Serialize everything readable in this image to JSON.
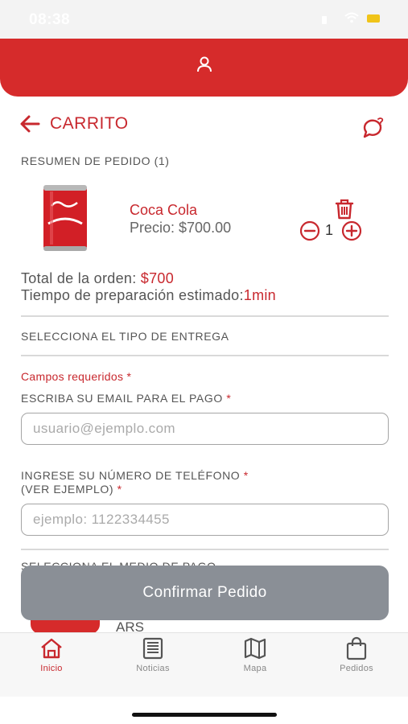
{
  "status_bar": {
    "time": "08:38"
  },
  "header": {
    "icon": "user-icon"
  },
  "cart": {
    "title": "CARRITO"
  },
  "summary": {
    "label": "RESUMEN DE PEDIDO (1)"
  },
  "product": {
    "name": "Coca Cola",
    "price": "Precio: $700.00",
    "quantity": "1",
    "image_icon": "coca-cola-can-icon"
  },
  "order": {
    "total_label": "Total de la orden: ",
    "total_value": "$700",
    "prep_label": "Tiempo de preparación estimado:",
    "prep_value": "1min"
  },
  "delivery": {
    "label": "SELECCIONA EL TIPO DE ENTREGA"
  },
  "form": {
    "required_note": "Campos requeridos",
    "required_mark": "*",
    "email_label": "ESCRIBA SU EMAIL PARA EL PAGO",
    "email_placeholder": "usuario@ejemplo.com",
    "phone_label_line1": "INGRESE SU NÚMERO DE TELÉFONO",
    "phone_label_line2": "(VER EJEMPLO)",
    "phone_placeholder": "ejemplo: 1122334455"
  },
  "payment": {
    "header": "SELECCIONA EL MEDIO DE PAGO",
    "option_text": "ARS"
  },
  "confirm_button": {
    "label": "Confirmar Pedido"
  },
  "tabs": [
    {
      "label": "Inicio",
      "icon": "home-icon",
      "active": true
    },
    {
      "label": "Noticias",
      "icon": "news-icon",
      "active": false
    },
    {
      "label": "Mapa",
      "icon": "map-icon",
      "active": false
    },
    {
      "label": "Pedidos",
      "icon": "shopping-bag-icon",
      "active": false
    }
  ],
  "colors": {
    "brand_red": "#d62b2b",
    "accent_red": "#c8282e",
    "button_gray": "#8a8f96"
  }
}
